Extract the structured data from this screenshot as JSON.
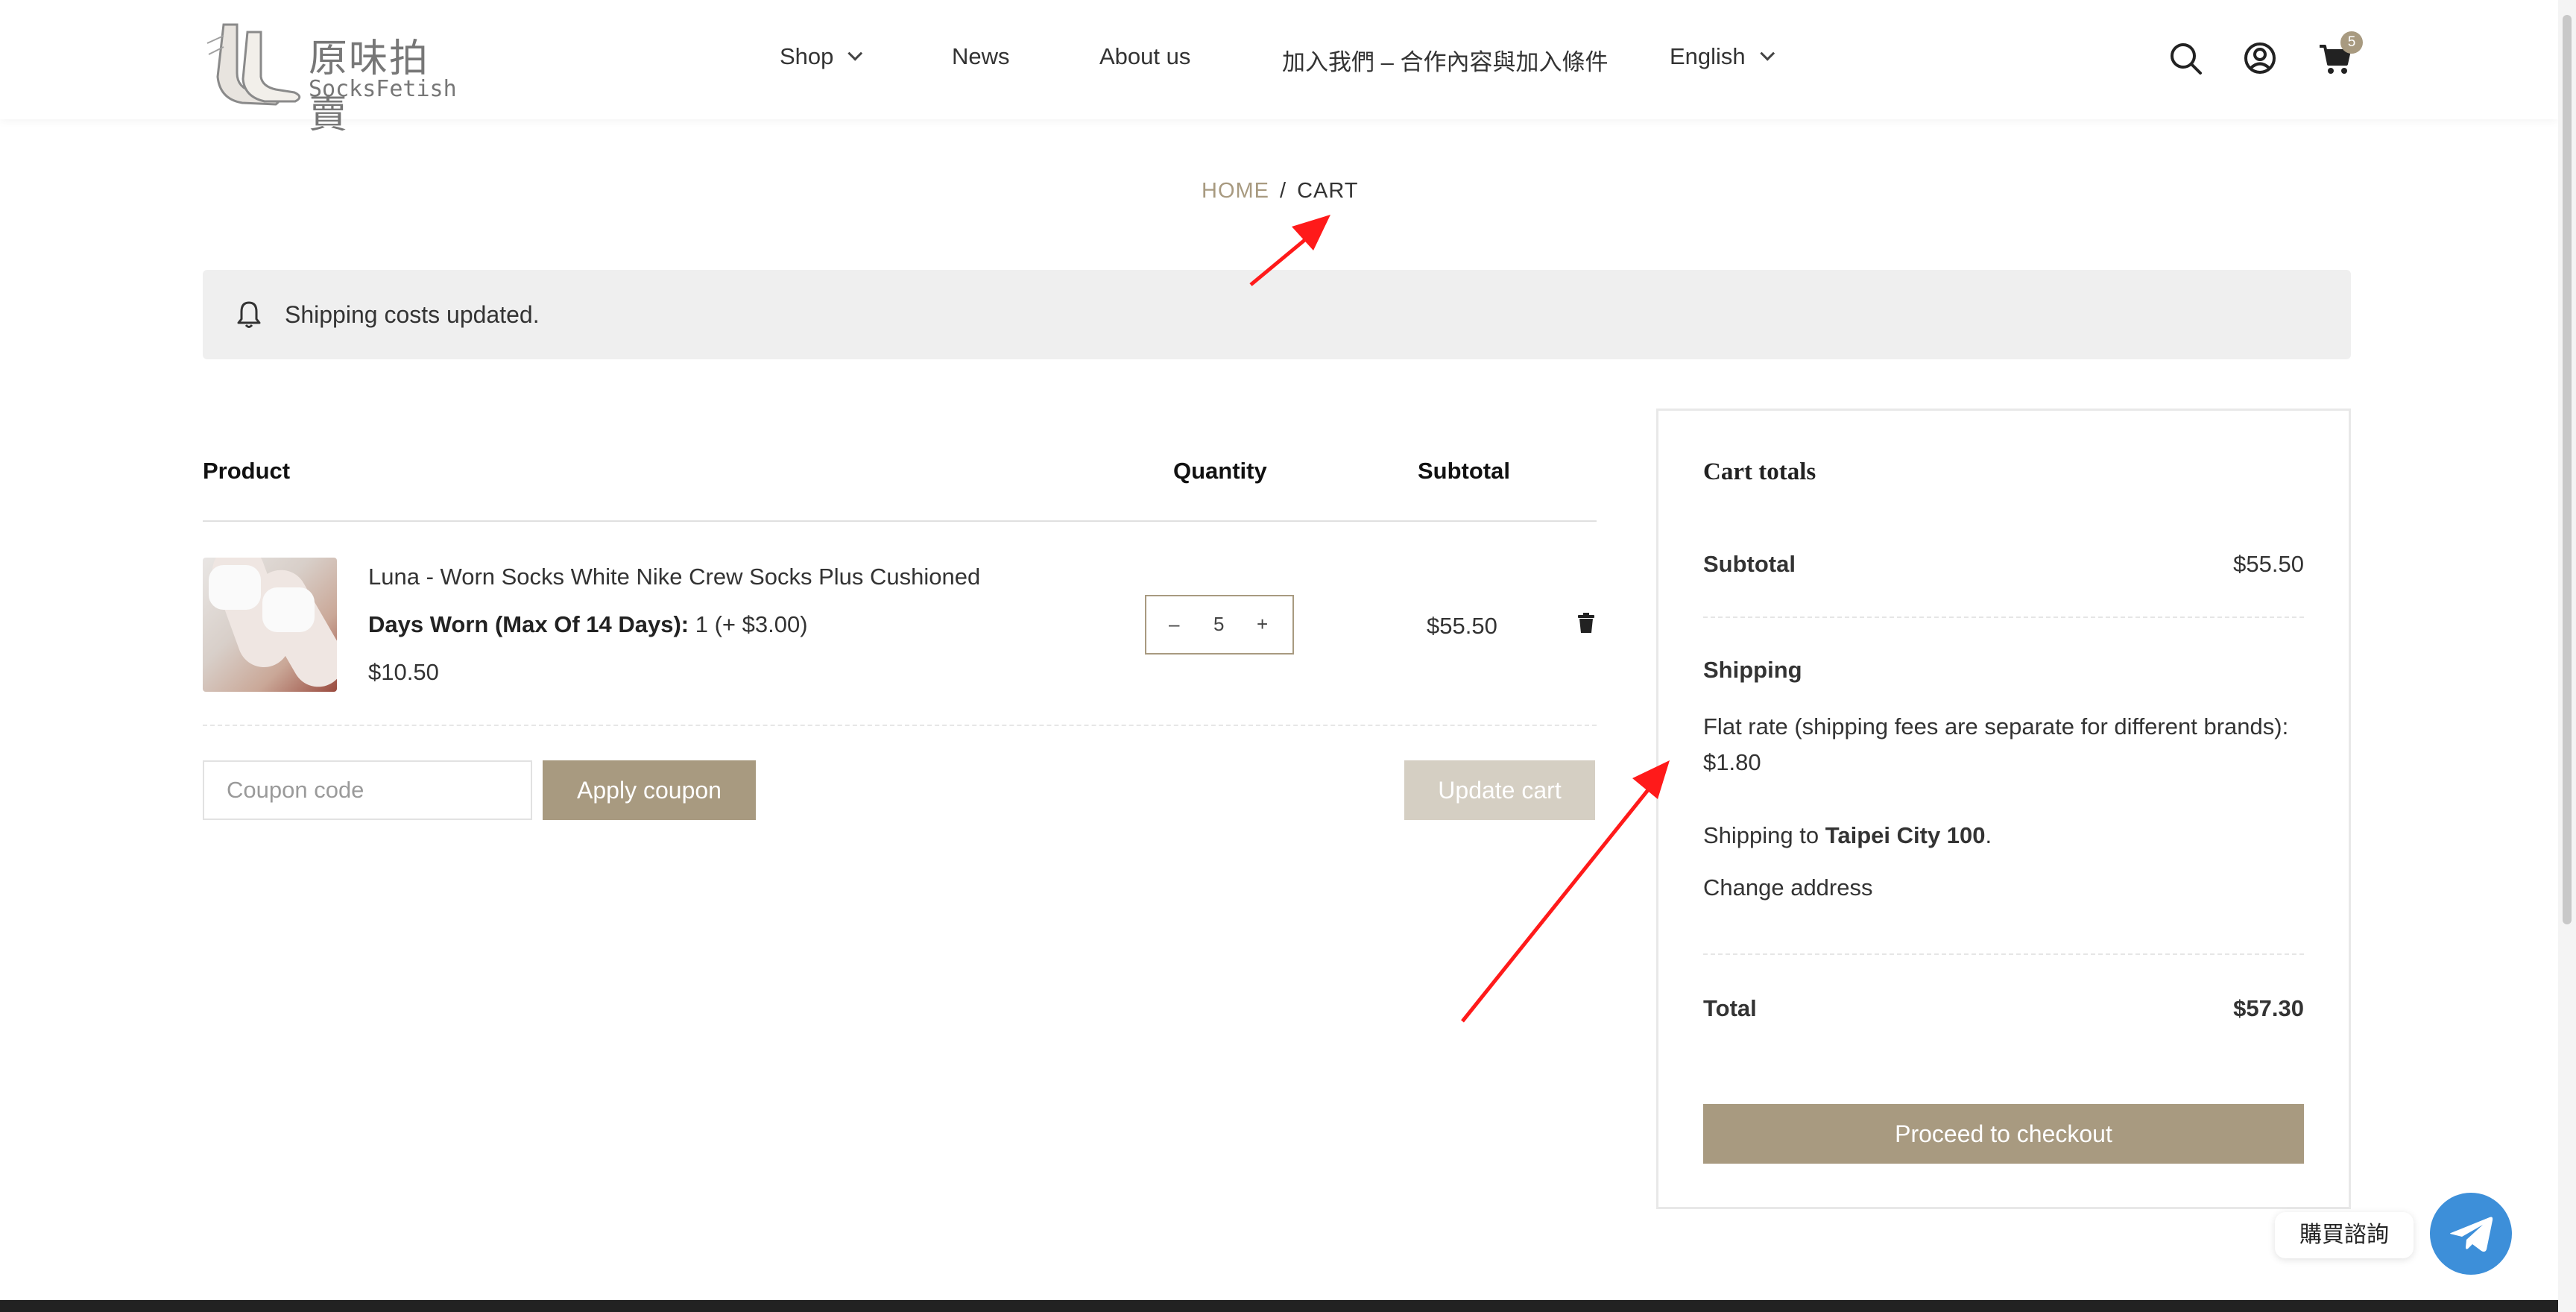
{
  "header": {
    "logo_title": "原味拍賣",
    "logo_subtitle": "SocksFetish",
    "nav": [
      {
        "label": "Shop",
        "has_dropdown": true
      },
      {
        "label": "News",
        "has_dropdown": false
      },
      {
        "label": "About us",
        "has_dropdown": false
      },
      {
        "label": "加入我們 – 合作內容與加入條件",
        "has_dropdown": false
      },
      {
        "label": "English",
        "has_dropdown": true
      }
    ],
    "icons": [
      "search-icon",
      "account-icon",
      "cart-icon"
    ],
    "cart_count": "5"
  },
  "breadcrumb": {
    "home": "HOME",
    "separator": "/",
    "current": "CART"
  },
  "notice": {
    "text": "Shipping costs updated.",
    "icon": "bell-icon"
  },
  "cart_table": {
    "headers": {
      "product": "Product",
      "quantity": "Quantity",
      "subtotal": "Subtotal"
    },
    "items": [
      {
        "name": "Luna - Worn Socks White Nike Crew Socks Plus Cushioned",
        "meta_label": "Days Worn (Max Of 14 Days):",
        "meta_value": " 1 (+ $3.00)",
        "price": "$10.50",
        "quantity": "5",
        "subtotal": "$55.50"
      }
    ],
    "qty_minus": "–",
    "qty_plus": "+"
  },
  "coupon": {
    "placeholder": "Coupon code",
    "apply_label": "Apply coupon"
  },
  "update_label": "Update cart",
  "totals": {
    "title": "Cart totals",
    "subtotal_label": "Subtotal",
    "subtotal_value": "$55.50",
    "shipping_label": "Shipping",
    "shipping_method": "Flat rate (shipping fees are separate for different brands):",
    "shipping_cost": "$1.80",
    "shipping_to_prefix": "Shipping to ",
    "shipping_to_place": "Taipei City 100",
    "shipping_to_suffix": ".",
    "change_address": "Change address",
    "total_label": "Total",
    "total_value": "$57.30",
    "checkout_label": "Proceed to checkout"
  },
  "chat": {
    "label": "購買諮詢"
  },
  "colors": {
    "accent": "#a89a80",
    "accent_light": "#d5cfc3",
    "chat_blue": "#3d8fd9",
    "annotation_red": "#ff1a1a"
  }
}
